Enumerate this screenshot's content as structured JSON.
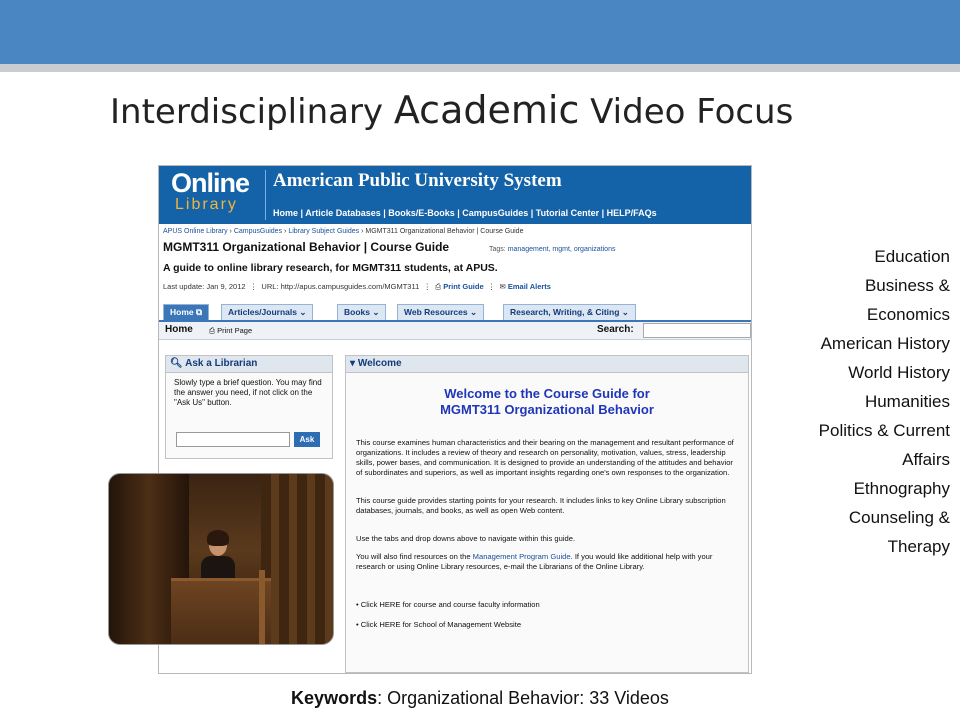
{
  "slide": {
    "title_part1": "Interdisciplinary ",
    "title_part2": "Academic",
    "title_part3": " Video Focus"
  },
  "screenshot": {
    "logo_line1": "Online",
    "logo_line2": "Library",
    "site_title": "American Public University System",
    "top_nav": "Home | Article Databases | Books/E-Books | CampusGuides | Tutorial Center | HELP/FAQs",
    "breadcrumbs": {
      "items": [
        "APUS Online Library",
        "CampusGuides",
        "Library Subject Guides",
        "MGMT311 Organizational Behavior | Course Guide"
      ]
    },
    "guide_title": "MGMT311 Organizational Behavior | Course Guide",
    "tags_label": "Tags:",
    "tags": "management, mgmt, organizations",
    "guide_description": "A guide to online library research, for MGMT311 students, at APUS.",
    "last_update": "Last update: Jan 9, 2012",
    "url": "URL: http://apus.campusguides.com/MGMT311",
    "print_guide": "Print Guide",
    "email_alerts": "Email Alerts",
    "tabs": [
      {
        "label": "Home"
      },
      {
        "label": "Articles/Journals"
      },
      {
        "label": "Books"
      },
      {
        "label": "Web Resources"
      },
      {
        "label": "Research, Writing, & Citing"
      }
    ],
    "subbar_home": "Home",
    "print_page": "Print Page",
    "search_label": "Search:",
    "ask": {
      "heading": "Ask a Librarian",
      "text": "Slowly type a brief question. You may find the answer you need, if not click on the \"Ask Us\" button.",
      "button": "Ask"
    },
    "welcome": {
      "heading": "Welcome",
      "title_line1": "Welcome to the Course Guide for",
      "title_line2": "MGMT311 Organizational Behavior",
      "para1": "This course examines human characteristics and their bearing on the management and resultant performance of organizations. It includes a review of theory and research on personality, motivation, values, stress, leadership skills, power bases, and communication. It is designed to provide an understanding of the attitudes and behavior of subordinates and superiors, as well as important insights regarding one's own responses to the organization.",
      "para2": "This course guide provides starting points for your research. It includes links to key Online Library subscription databases, journals, and books, as well as open Web content.",
      "para3": "Use the tabs and drop downs above to navigate within this guide.",
      "para4_a": "You will also find resources on the ",
      "para4_link": "Management Program Guide",
      "para4_b": ". If you would like additional help with your research or using Online Library resources, e-mail the Librarians of the Online Library.",
      "bullet1": "Click HERE for course and course faculty information",
      "bullet2": "Click HERE for School of Management Website"
    }
  },
  "topics": [
    "Education",
    "Business &",
    "Economics",
    "American History",
    "World History",
    "Humanities",
    "Politics & Current",
    "Affairs",
    "Ethnography",
    "Counseling &",
    "Therapy"
  ],
  "keywords": {
    "label": "Keywords",
    "text": ": Organizational Behavior: 33 Videos"
  },
  "colors": {
    "top_bar": "#4a86c2",
    "site_header": "#1463a8",
    "logo_accent": "#f1b43c",
    "welcome_title": "#1f36b8"
  }
}
